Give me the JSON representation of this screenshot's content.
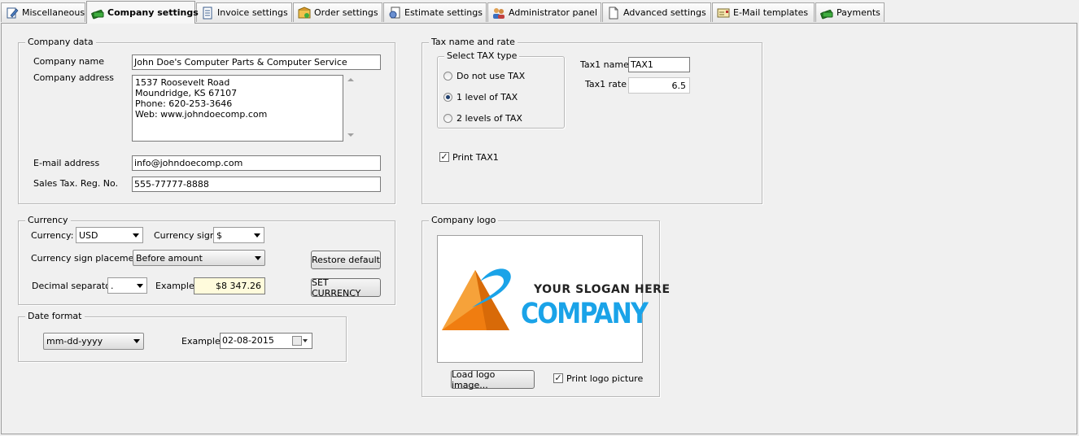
{
  "tabs": [
    {
      "label": "Miscellaneous",
      "icon": "edit-document-icon"
    },
    {
      "label": "Company settings",
      "icon": "money-icon"
    },
    {
      "label": "Invoice settings",
      "icon": "invoice-icon"
    },
    {
      "label": "Order settings",
      "icon": "order-icon"
    },
    {
      "label": "Estimate settings",
      "icon": "estimate-icon"
    },
    {
      "label": "Administrator panel",
      "icon": "users-icon"
    },
    {
      "label": "Advanced settings",
      "icon": "document-icon"
    },
    {
      "label": "E-Mail templates",
      "icon": "email-icon"
    },
    {
      "label": "Payments",
      "icon": "money-icon"
    }
  ],
  "active_tab": "Company settings",
  "company": {
    "legend": "Company data",
    "name_label": "Company name",
    "name_value": "John Doe's Computer Parts & Computer Service",
    "address_label": "Company address",
    "address_lines": [
      "1537 Roosevelt Road",
      "Moundridge, KS 67107",
      "Phone: 620-253-3646",
      "Web: www.johndoecomp.com"
    ],
    "email_label": "E-mail address",
    "email_value": "info@johndoecomp.com",
    "taxreg_label": "Sales Tax. Reg. No.",
    "taxreg_value": "555-77777-8888"
  },
  "currency": {
    "legend": "Currency",
    "currency_label": "Currency:",
    "currency_value": "USD",
    "sign_label": "Currency sign",
    "sign_value": "$",
    "placement_label": "Currency sign placement",
    "placement_value": "Before amount",
    "decimal_label": "Decimal separator",
    "decimal_value": ".",
    "example_label": "Example:",
    "example_value": "$8 347.26",
    "restore_button": "Restore default",
    "set_button": "SET CURRENCY"
  },
  "date": {
    "legend": "Date format",
    "format_value": "mm-dd-yyyy",
    "example_label": "Example:",
    "example_value": "02-08-2015"
  },
  "tax": {
    "legend": "Tax name and rate",
    "type_legend": "Select TAX type",
    "options": [
      "Do not use TAX",
      "1 level of TAX",
      "2 levels of TAX"
    ],
    "selected_option": "1 level of TAX",
    "tax1_name_label": "Tax1 name",
    "tax1_name_value": "TAX1",
    "tax1_rate_label": "Tax1 rate",
    "tax1_rate_value": "6.5",
    "print_tax1_label": "Print TAX1",
    "print_tax1_checked": true
  },
  "logo": {
    "legend": "Company logo",
    "slogan": "YOUR SLOGAN HERE",
    "company_word": "COMPANY",
    "load_button": "Load logo image...",
    "print_label": "Print logo picture",
    "print_checked": true
  },
  "colors": {
    "panel_bg": "#f0f0f0",
    "logo_orange": "#f07d10",
    "logo_blue": "#1aa3e8",
    "example_bg": "#fffbdc"
  }
}
